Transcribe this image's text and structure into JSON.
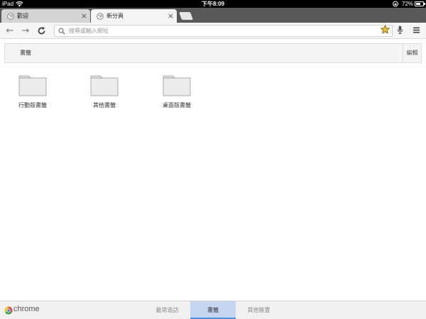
{
  "status_bar": {
    "device": "iPad",
    "time": "下午8:09",
    "battery_percent": "72%",
    "battery_level": 0.72
  },
  "tabs": [
    {
      "label": "歡迎",
      "active": false,
      "icon": "globe-icon"
    },
    {
      "label": "新分頁",
      "active": true,
      "icon": "globe-icon"
    }
  ],
  "toolbar": {
    "omnibox_placeholder": "搜尋或輸入網址",
    "omnibox_value": ""
  },
  "bookmarks": {
    "title": "書籤",
    "edit_label": "編輯",
    "folders": [
      {
        "label": "行動版書籤",
        "icon": "folder-icon"
      },
      {
        "label": "其他書籤",
        "icon": "folder-icon"
      },
      {
        "label": "桌面版書籤",
        "icon": "folder-icon"
      }
    ]
  },
  "bottom_bar": {
    "brand": "chrome",
    "tabs": [
      {
        "label": "最常造訪",
        "active": false
      },
      {
        "label": "書籤",
        "active": true
      },
      {
        "label": "其他裝置",
        "active": false
      }
    ]
  },
  "colors": {
    "accent": "#4a90e2",
    "active_tab_highlight": "#c4d6f1",
    "star": "#f2c12e"
  }
}
